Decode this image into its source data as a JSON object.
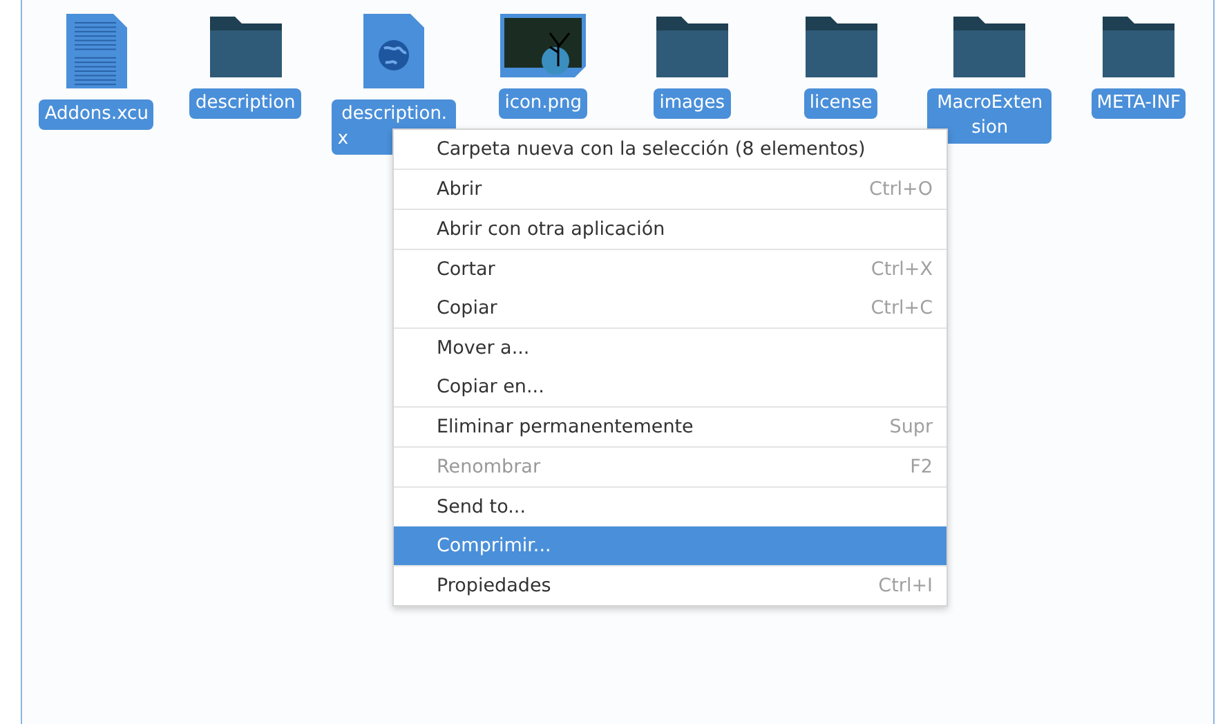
{
  "files": [
    {
      "name": "Addons.xcu",
      "kind": "document",
      "selected": true
    },
    {
      "name": "description",
      "kind": "folder",
      "selected": true
    },
    {
      "name": "description.x",
      "kind": "web",
      "selected": true
    },
    {
      "name": "icon.png",
      "kind": "image",
      "selected": true
    },
    {
      "name": "images",
      "kind": "folder",
      "selected": true
    },
    {
      "name": "license",
      "kind": "folder",
      "selected": true
    },
    {
      "name": "MacroExtension",
      "kind": "folder",
      "selected": true
    },
    {
      "name": "META-INF",
      "kind": "folder",
      "selected": true
    }
  ],
  "context_menu": {
    "groups": [
      [
        {
          "label": "Carpeta nueva con la selección (8 elementos)",
          "disabled": false,
          "highlighted": false
        }
      ],
      [
        {
          "label": "Abrir",
          "shortcut": "Ctrl+O",
          "disabled": false,
          "highlighted": false
        }
      ],
      [
        {
          "label": "Abrir con otra aplicación",
          "disabled": false,
          "highlighted": false
        }
      ],
      [
        {
          "label": "Cortar",
          "shortcut": "Ctrl+X",
          "disabled": false,
          "highlighted": false
        },
        {
          "label": "Copiar",
          "shortcut": "Ctrl+C",
          "disabled": false,
          "highlighted": false
        }
      ],
      [
        {
          "label": "Mover a...",
          "disabled": false,
          "highlighted": false
        },
        {
          "label": "Copiar en...",
          "disabled": false,
          "highlighted": false
        }
      ],
      [
        {
          "label": "Eliminar permanentemente",
          "shortcut": "Supr",
          "disabled": false,
          "highlighted": false
        }
      ],
      [
        {
          "label": "Renombrar",
          "shortcut": "F2",
          "disabled": true,
          "highlighted": false
        }
      ],
      [
        {
          "label": "Send to...",
          "disabled": false,
          "highlighted": false
        },
        {
          "label": "Comprimir...",
          "disabled": false,
          "highlighted": true
        }
      ],
      [
        {
          "label": "Propiedades",
          "shortcut": "Ctrl+I",
          "disabled": false,
          "highlighted": false
        }
      ]
    ]
  }
}
